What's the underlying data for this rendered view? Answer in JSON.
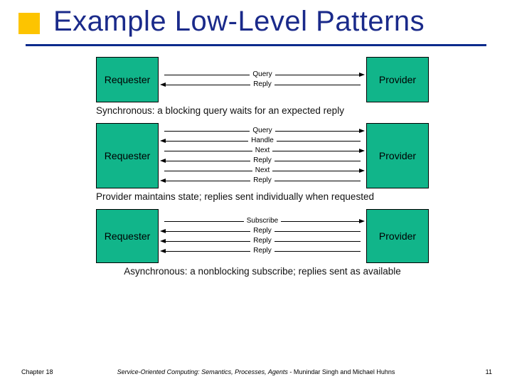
{
  "title": "Example Low-Level Patterns",
  "patterns": [
    {
      "left": "Requester",
      "right": "Provider",
      "messages": [
        {
          "dir": "right",
          "label": "Query"
        },
        {
          "dir": "left",
          "label": "Reply"
        }
      ],
      "caption": "Synchronous: a blocking query waits for an expected reply",
      "captionAlign": "left",
      "nodeHeight": 64
    },
    {
      "left": "Requester",
      "right": "Provider",
      "messages": [
        {
          "dir": "right",
          "label": "Query"
        },
        {
          "dir": "left",
          "label": "Handle"
        },
        {
          "dir": "right",
          "label": "Next"
        },
        {
          "dir": "left",
          "label": "Reply"
        },
        {
          "dir": "right",
          "label": "Next"
        },
        {
          "dir": "left",
          "label": "Reply"
        }
      ],
      "caption": "Provider maintains state; replies sent individually when requested",
      "captionAlign": "left",
      "nodeHeight": 92
    },
    {
      "left": "Requester",
      "right": "Provider",
      "messages": [
        {
          "dir": "right",
          "label": "Subscribe"
        },
        {
          "dir": "left",
          "label": "Reply"
        },
        {
          "dir": "left",
          "label": "Reply"
        },
        {
          "dir": "left",
          "label": "Reply"
        }
      ],
      "caption": "Asynchronous: a nonblocking subscribe; replies sent as available",
      "captionAlign": "center",
      "nodeHeight": 76
    }
  ],
  "footer": {
    "chapter": "Chapter 18",
    "book": "Service-Oriented Computing: Semantics, Processes, Agents",
    "authors": " - Munindar Singh and Michael Huhns",
    "page": "11"
  },
  "colors": {
    "accent": "#1a2a8a",
    "bullet": "#fdc400",
    "node": "#11b58a"
  }
}
